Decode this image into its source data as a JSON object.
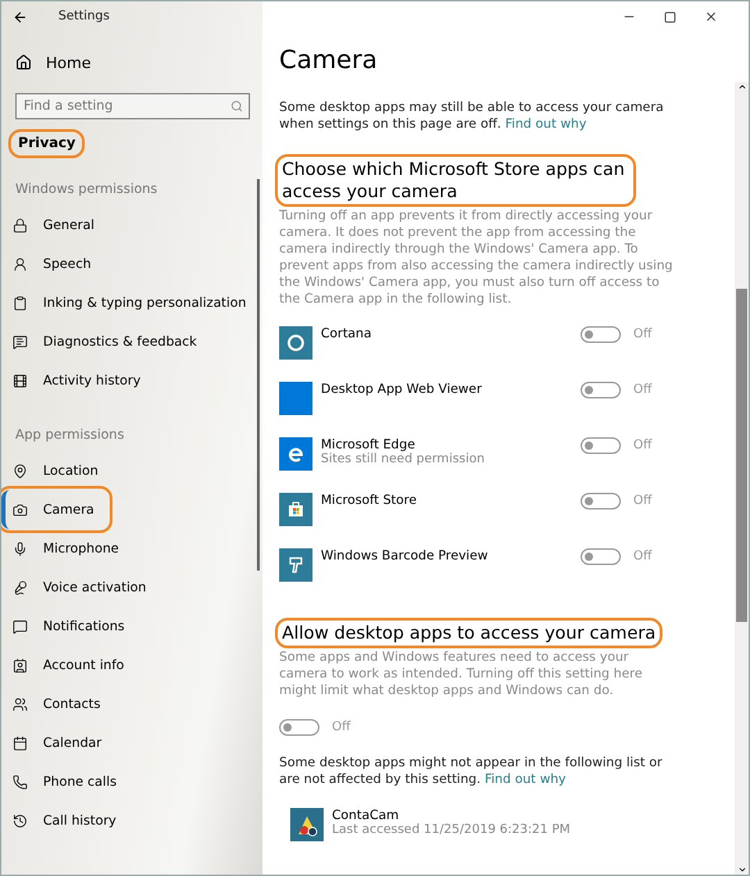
{
  "window": {
    "title": "Settings"
  },
  "sidebar": {
    "home": "Home",
    "search": {
      "placeholder": "Find a setting"
    },
    "category": {
      "label": "Privacy",
      "highlighted": true
    },
    "groups": [
      {
        "heading": "Windows permissions",
        "items": [
          {
            "label": "General",
            "selected": false,
            "highlighted": false
          },
          {
            "label": "Speech",
            "selected": false,
            "highlighted": false
          },
          {
            "label": "Inking & typing personalization",
            "selected": false,
            "highlighted": false
          },
          {
            "label": "Diagnostics & feedback",
            "selected": false,
            "highlighted": false
          },
          {
            "label": "Activity history",
            "selected": false,
            "highlighted": false
          }
        ]
      },
      {
        "heading": "App permissions",
        "items": [
          {
            "label": "Location",
            "selected": false,
            "highlighted": false
          },
          {
            "label": "Camera",
            "selected": true,
            "highlighted": true
          },
          {
            "label": "Microphone",
            "selected": false,
            "highlighted": false
          },
          {
            "label": "Voice activation",
            "selected": false,
            "highlighted": false
          },
          {
            "label": "Notifications",
            "selected": false,
            "highlighted": false
          },
          {
            "label": "Account info",
            "selected": false,
            "highlighted": false
          },
          {
            "label": "Contacts",
            "selected": false,
            "highlighted": false
          },
          {
            "label": "Calendar",
            "selected": false,
            "highlighted": false
          },
          {
            "label": "Phone calls",
            "selected": false,
            "highlighted": false
          },
          {
            "label": "Call history",
            "selected": false,
            "highlighted": false
          }
        ]
      }
    ]
  },
  "page": {
    "title": "Camera",
    "intro": "Some desktop apps may still be able to access your camera when settings on this page are off.",
    "intro_link": "Find out why",
    "store_section": {
      "heading": "Choose which Microsoft Store apps can access your camera",
      "highlighted": true,
      "description": "Turning off an app prevents it from directly accessing your camera. It does not prevent the app from accessing the camera indirectly through the Windows' Camera app. To prevent apps from also accessing the camera indirectly using the Windows' Camera app, you must also turn off access to the Camera app in the following list.",
      "apps": [
        {
          "name": "Cortana",
          "on": false,
          "status": "Off",
          "color": "#2d7d9a"
        },
        {
          "name": "Desktop App Web Viewer",
          "on": false,
          "status": "Off",
          "color": "#0078d7"
        },
        {
          "name": "Microsoft Edge",
          "subtitle": "Sites still need permission",
          "on": false,
          "status": "Off",
          "color": "#0078d7"
        },
        {
          "name": "Microsoft Store",
          "on": false,
          "status": "Off",
          "color": "#2d7d9a"
        },
        {
          "name": "Windows Barcode Preview",
          "on": false,
          "status": "Off",
          "color": "#2d7d9a"
        }
      ]
    },
    "desktop_section": {
      "heading": "Allow desktop apps to access your camera",
      "highlighted": true,
      "description": "Some apps and Windows features need to access your camera to work as intended. Turning off this setting here might limit what desktop apps and Windows can do.",
      "on": false,
      "status": "Off",
      "note": "Some desktop apps might not appear in the following list or are not affected by this setting.",
      "note_link": "Find out why",
      "apps": [
        {
          "name": "ContaCam",
          "detail": "Last accessed 11/25/2019 6:23:21 PM"
        }
      ]
    }
  }
}
